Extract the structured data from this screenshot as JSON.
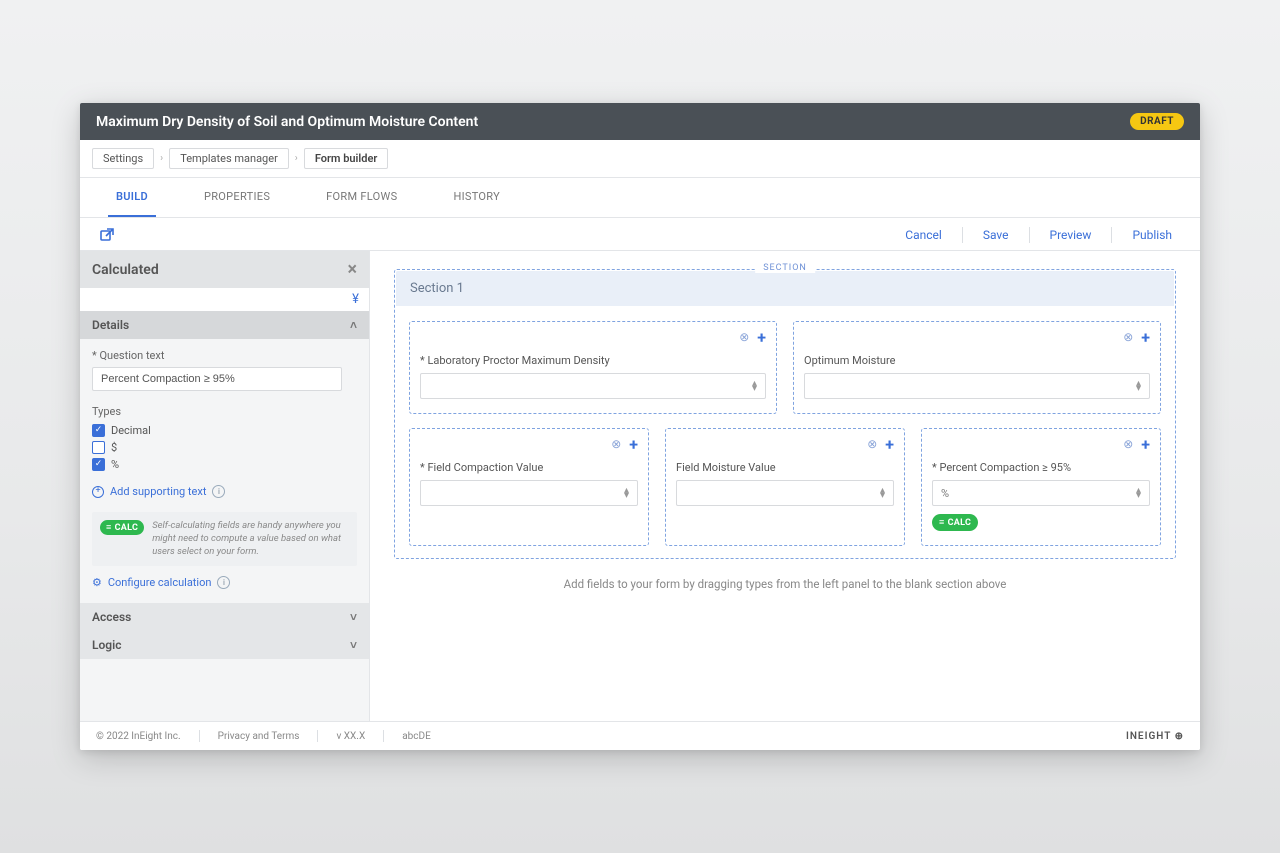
{
  "header": {
    "title": "Maximum Dry Density of Soil and Optimum Moisture Content",
    "status_badge": "DRAFT"
  },
  "breadcrumb": {
    "items": [
      "Settings",
      "Templates manager",
      "Form builder"
    ]
  },
  "tabs": {
    "items": [
      "BUILD",
      "PROPERTIES",
      "FORM FLOWS",
      "HISTORY"
    ],
    "active_index": 0
  },
  "actions": {
    "cancel": "Cancel",
    "save": "Save",
    "preview": "Preview",
    "publish": "Publish"
  },
  "sidebar": {
    "panel_title": "Calculated",
    "details": {
      "heading": "Details",
      "question_label": "* Question text",
      "question_value": "Percent Compaction ≥ 95%",
      "types_label": "Types",
      "types": [
        {
          "name": "Decimal",
          "checked": true
        },
        {
          "name": "$",
          "checked": false
        },
        {
          "name": "%",
          "checked": true
        }
      ],
      "support_link": "Add supporting text",
      "calc_badge": "CALC",
      "calc_note": "Self-calculating fields are handy anywhere you might need to compute a value based on what users select on your form.",
      "config_link": "Configure calculation"
    },
    "access_heading": "Access",
    "logic_heading": "Logic"
  },
  "canvas": {
    "section_tag": "SECTION",
    "section_title": "Section 1",
    "row1": [
      {
        "label": "* Laboratory Proctor Maximum Density",
        "prefix": ""
      },
      {
        "label": "Optimum Moisture",
        "prefix": ""
      }
    ],
    "row2": [
      {
        "label": "* Field Compaction Value",
        "prefix": ""
      },
      {
        "label": "Field Moisture Value",
        "prefix": ""
      },
      {
        "label": "* Percent Compaction ≥ 95%",
        "prefix": "%",
        "calc": true
      }
    ],
    "hint": "Add fields to your form by dragging types from the left panel to the blank section above"
  },
  "footer": {
    "copyright": "© 2022 InEight Inc.",
    "privacy": "Privacy and Terms",
    "version": "v XX.X",
    "env": "abcDE",
    "brand": "INEIGHT"
  }
}
